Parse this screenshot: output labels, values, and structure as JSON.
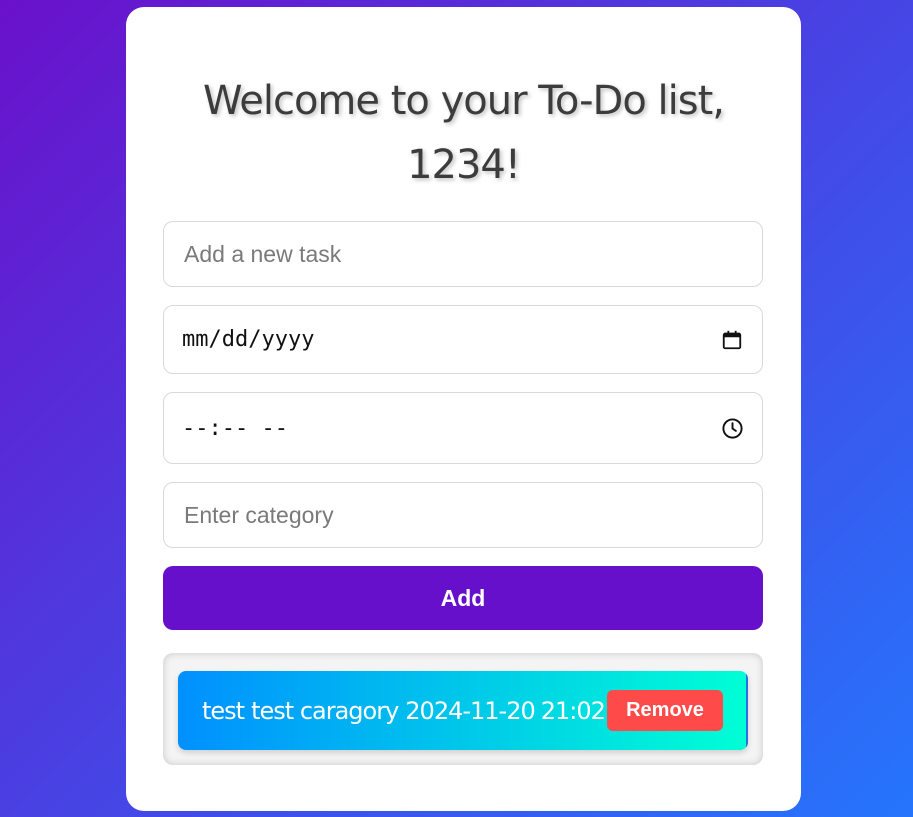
{
  "header": {
    "title_line1": "Welcome to your To-Do list,",
    "title_line2": "1234!"
  },
  "form": {
    "task_input": {
      "value": "",
      "placeholder": "Add a new task"
    },
    "date_input": {
      "display": "mm/dd/yyyy",
      "icon": "calendar-icon"
    },
    "time_input": {
      "display": "--:-- --",
      "icon": "clock-icon"
    },
    "category_input": {
      "value": "",
      "placeholder": "Enter category"
    },
    "add_label": "Add"
  },
  "tasks": [
    {
      "name": "test",
      "category": "test caragory",
      "date": "2024-11-20",
      "time": "21:02",
      "remove_label": "Remove"
    }
  ],
  "colors": {
    "background_start": "#6a11cb",
    "background_end": "#2575fc",
    "add_button": "#6610cc",
    "remove_button": "#ff4a4a",
    "task_gradient_start": "#0090ff",
    "task_gradient_end": "#00ffd5"
  }
}
